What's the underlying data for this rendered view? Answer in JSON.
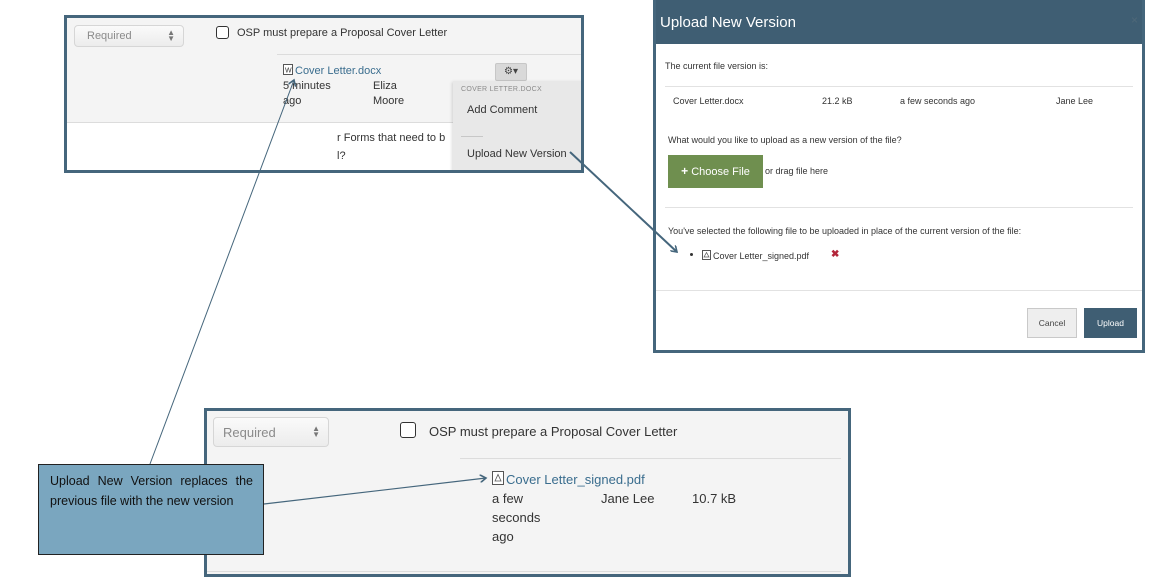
{
  "top_snippet": {
    "select_value": "Required",
    "requirement_label": "OSP must prepare a Proposal Cover Letter",
    "file": {
      "name": "Cover Letter.docx",
      "icon": "word-doc-icon",
      "time_line1": "5 minutes",
      "time_line2": "ago",
      "user_line1": "Eliza",
      "user_line2": "Moore"
    },
    "partial_row_line1": "r Forms that need to b",
    "partial_row_line2": "l?",
    "gear_menu": {
      "button_icon": "gear-icon",
      "header": "COVER LETTER.DOCX",
      "items": [
        "Add Comment",
        "Upload New Version"
      ]
    }
  },
  "modal": {
    "title": "Upload New Version",
    "close_icon": "×",
    "current_version_label": "The current file version is:",
    "current_file": {
      "name": "Cover Letter.docx",
      "size": "21.2 kB",
      "time": "a few seconds ago",
      "user": "Jane Lee"
    },
    "upload_prompt": "What would you like to upload as a new version of the file?",
    "choose_file_label": "Choose File",
    "drag_hint": "or drag file here",
    "selected_label": "You've selected the following file to be uploaded in place of the current version of the file:",
    "selected_file": "Cover Letter_signed.pdf",
    "cancel_label": "Cancel",
    "upload_label": "Upload",
    "colors": {
      "header": "#3f5e73",
      "choose_button": "#6f8f4f",
      "remove": "#b3263a"
    }
  },
  "bottom_snippet": {
    "select_value": "Required",
    "requirement_label": "OSP must prepare a Proposal Cover Letter",
    "file": {
      "name": "Cover Letter_signed.pdf",
      "icon": "pdf-icon",
      "time_line1": "a few",
      "time_line2": "seconds",
      "time_line3": "ago",
      "user": "Jane Lee",
      "size": "10.7 kB"
    }
  },
  "callout": {
    "text": "Upload New Version replaces the previous file with the new version"
  },
  "colors": {
    "frame_border": "#45667c",
    "callout_bg": "#7aa6bf",
    "link": "#3a6d8e"
  }
}
